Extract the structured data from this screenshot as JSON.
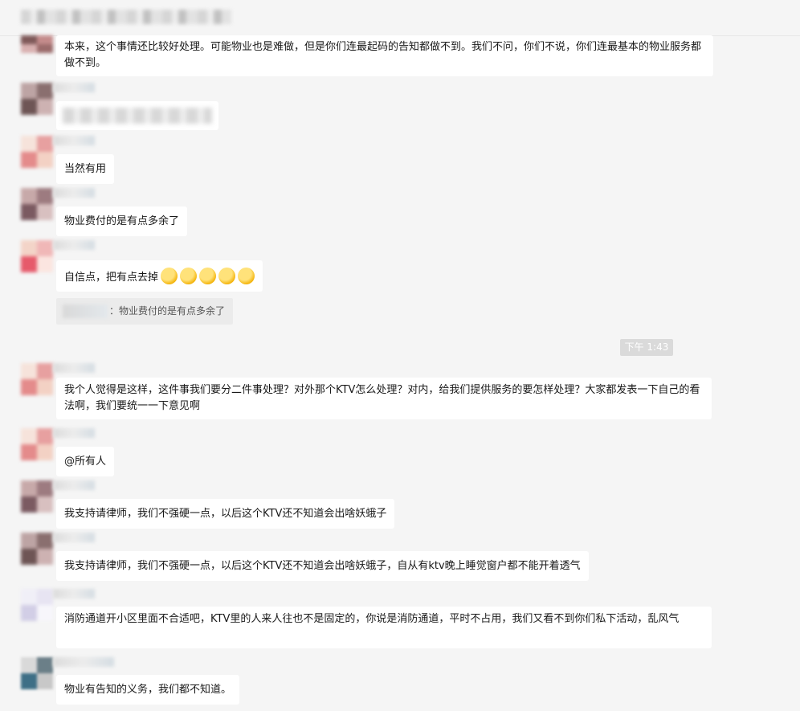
{
  "messages": [
    "本来，这个事情还比较好处理。可能物业也是难做，但是你们连最起码的告知都做不到。我们不问，你们不说，你们连最基本的物业服务都做不到。",
    "当然有用",
    "物业费付的是有点多余了",
    "自信点，把有点去掉",
    "我个人觉得是这样，这件事我们要分二件事处理？对外那个KTV怎么处理？对内，给我们提供服务的要怎样处理？大家都发表一下自己的看法啊，我们要统一一下意见啊",
    "@所有人",
    "我支持请律师，我们不强硬一点，以后这个KTV还不知道会出啥妖蛾子",
    "我支持请律师，我们不强硬一点，以后这个KTV还不知道会出啥妖蛾子，自从有ktv晚上睡觉窗户都不能开着透气",
    "消防通道开小区里面不合适吧，KTV里的人来人往也不是固定的，你说是消防通道，平时不占用，我们又看不到你们私下活动，乱风气",
    "物业有告知的义务，我们都不知道。"
  ],
  "quote": {
    "text": "：物业费付的是有点多余了"
  },
  "timestamp": "下午 1:43",
  "emoji_icon": "thinking-face-icon",
  "emoji_count": 5
}
